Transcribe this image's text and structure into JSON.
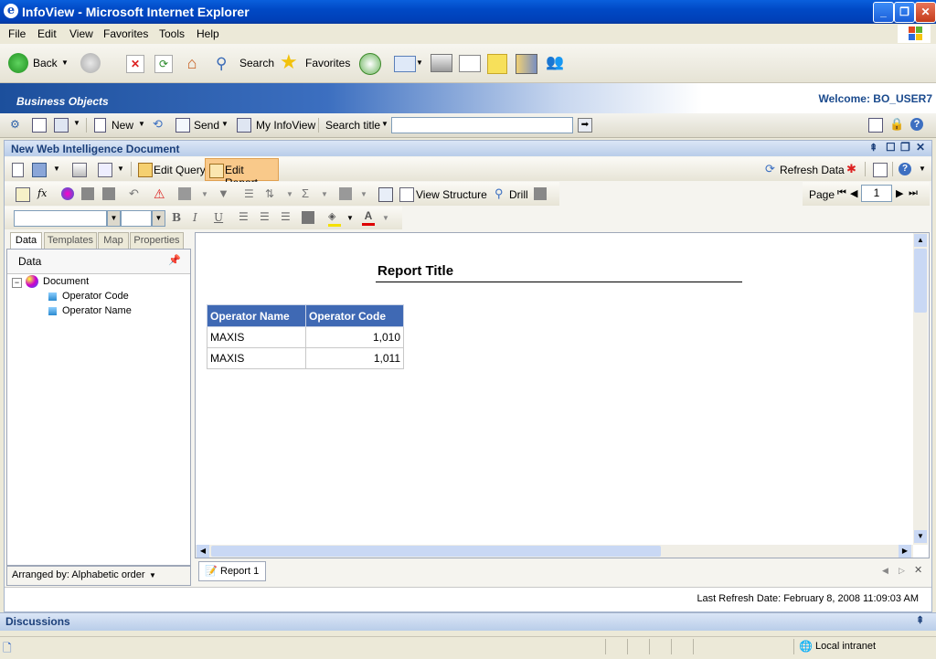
{
  "window": {
    "title": "InfoView - Microsoft Internet Explorer"
  },
  "menu": [
    "File",
    "Edit",
    "View",
    "Favorites",
    "Tools",
    "Help"
  ],
  "ie_toolbar": {
    "back": "Back",
    "search": "Search",
    "favorites": "Favorites"
  },
  "banner": {
    "logo": "Business Objects",
    "welcome": "Welcome:  BO_USER7"
  },
  "bo_toolbar": {
    "new": "New",
    "send": "Send",
    "my_infoview": "My InfoView",
    "search_title": "Search title",
    "search_value": ""
  },
  "document": {
    "title": "New Web Intelligence Document",
    "edit_query": "Edit Query",
    "edit_report": "Edit Report",
    "refresh_data": "Refresh Data",
    "view_structure": "View Structure",
    "drill": "Drill",
    "page_label": "Page",
    "page_value": "1",
    "font_name": "",
    "font_size": ""
  },
  "left_panel": {
    "tabs": [
      "Data",
      "Templates",
      "Map",
      "Properties"
    ],
    "header": "Data",
    "tree_root": "Document",
    "tree_items": [
      "Operator Code",
      "Operator Name"
    ],
    "footer": "Arranged by: Alphabetic order"
  },
  "report": {
    "title": "Report Title",
    "columns": [
      "Operator Name",
      "Operator Code"
    ],
    "rows": [
      [
        "MAXIS",
        "1,010"
      ],
      [
        "MAXIS",
        "1,011"
      ]
    ],
    "tab": "Report 1",
    "last_refresh": "Last Refresh Date: February 8, 2008 11:09:03 AM"
  },
  "discussions": "Discussions",
  "status": {
    "zone": "Local intranet"
  }
}
